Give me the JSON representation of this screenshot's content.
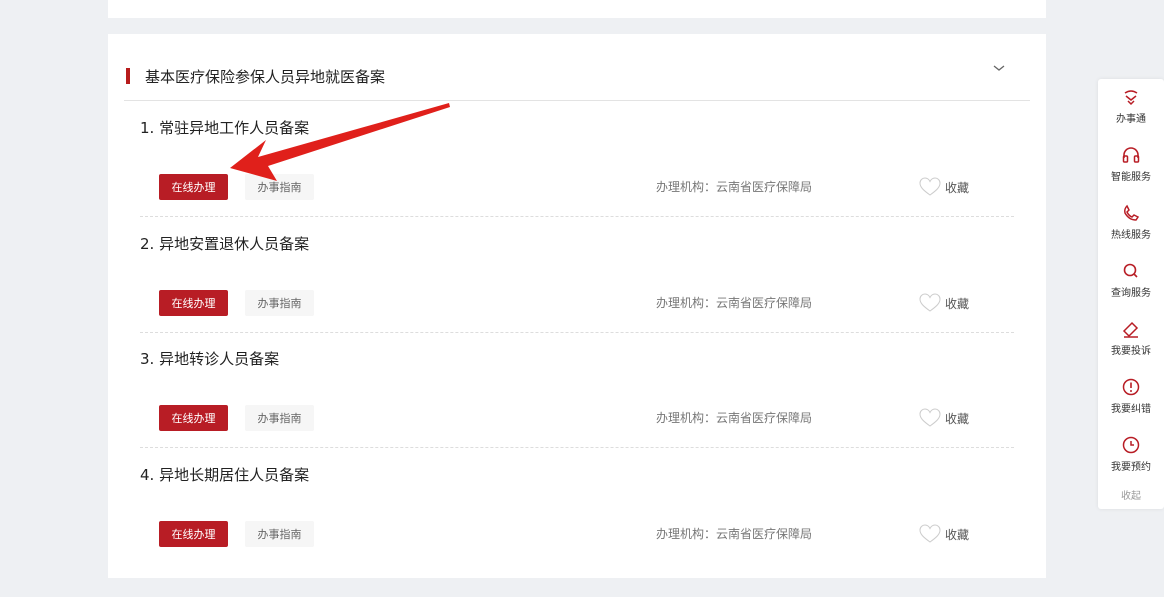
{
  "section": {
    "title": "基本医疗保险参保人员异地就医备案",
    "toggle_icon": "chevron-down-icon"
  },
  "items": [
    {
      "title": "1. 常驻异地工作人员备案",
      "online_label": "在线办理",
      "guide_label": "办事指南",
      "agency": "办理机构：云南省医疗保障局",
      "favorite_label": "收藏"
    },
    {
      "title": "2. 异地安置退休人员备案",
      "online_label": "在线办理",
      "guide_label": "办事指南",
      "agency": "办理机构：云南省医疗保障局",
      "favorite_label": "收藏"
    },
    {
      "title": "3. 异地转诊人员备案",
      "online_label": "在线办理",
      "guide_label": "办事指南",
      "agency": "办理机构：云南省医疗保障局",
      "favorite_label": "收藏"
    },
    {
      "title": "4. 异地长期居住人员备案",
      "online_label": "在线办理",
      "guide_label": "办事指南",
      "agency": "办理机构：云南省医疗保障局",
      "favorite_label": "收藏"
    }
  ],
  "side_panel": {
    "items": [
      {
        "label": "办事通",
        "icon": "service-logo-icon"
      },
      {
        "label": "智能服务",
        "icon": "headset-icon"
      },
      {
        "label": "热线服务",
        "icon": "phone-icon"
      },
      {
        "label": "查询服务",
        "icon": "search-icon"
      },
      {
        "label": "我要投诉",
        "icon": "complaint-icon"
      },
      {
        "label": "我要纠错",
        "icon": "alert-icon"
      },
      {
        "label": "我要预约",
        "icon": "clock-icon"
      }
    ],
    "collapse_label": "收起"
  },
  "colors": {
    "accent": "#b81d25",
    "annotation_arrow": "#e0201b"
  }
}
